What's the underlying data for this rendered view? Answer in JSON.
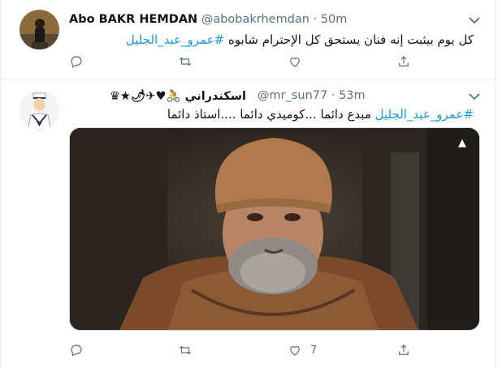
{
  "tweets": [
    {
      "name": "Abo BAKR HEMDAN",
      "handle": "@abobakrhemdan",
      "separator": "·",
      "time": "50m",
      "text": "كل يوم بيثبت إنه فنان يستحق كل الإحترام شابوه",
      "hashtag": "#عمرو_عبد_الجليل",
      "actions": {
        "reply": "",
        "retweet": "",
        "like": "",
        "share": ""
      }
    },
    {
      "name": "اسكندراني 🚴♥✈🌶",
      "name_prefix": "★♛",
      "handle": "@mr_sun77",
      "separator": "·",
      "time": "53m",
      "hashtag": "#عمرو_عبد_الجليل",
      "text": "مبدع دائما ...كوميدي دائما ....استاذ دائما",
      "media_watermark": "▲",
      "actions": {
        "reply": "",
        "retweet": "",
        "like": "7",
        "share": ""
      }
    }
  ],
  "colors": {
    "accent": "#1b95e0",
    "muted": "#5b7083",
    "text": "#0f1419",
    "border": "#e6ecf0"
  }
}
